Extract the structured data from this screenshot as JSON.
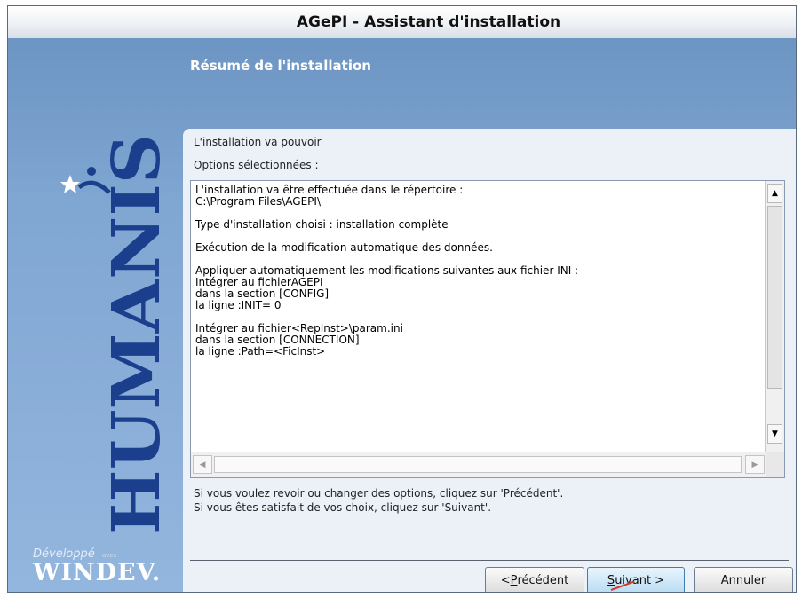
{
  "window": {
    "title": "AGePI - Assistant d'installation"
  },
  "sidebar": {
    "brand": "HUMANIS",
    "footer_developed": "Développé",
    "footer_avec": "avec",
    "footer_product": "WINDEV."
  },
  "page": {
    "section_title": "Résumé de l'installation",
    "intro": "L'installation va pouvoir",
    "options_label": "Options sélectionnées :",
    "summary_lines": [
      "L'installation va être effectuée dans le répertoire :",
      "C:\\Program Files\\AGEPI\\",
      "",
      "Type d'installation choisi : installation complète",
      "",
      "Exécution de la modification automatique des données.",
      "",
      "Appliquer automatiquement les modifications suivantes aux fichier INI :",
      "Intégrer au fichierAGEPI",
      "dans la section [CONFIG]",
      "la ligne :INIT= 0",
      "",
      "Intégrer au fichier<RepInst>\\param.ini",
      "dans la section [CONNECTION]",
      "la ligne :Path=<FicInst>"
    ],
    "help_line1": "Si vous voulez revoir ou changer des options, cliquez sur 'Précédent'.",
    "help_line2": "Si vous êtes satisfait de vos choix, cliquez sur 'Suivant'."
  },
  "buttons": {
    "previous": {
      "prefix": "< ",
      "accel": "P",
      "rest": "récédent"
    },
    "next": {
      "accel": "S",
      "rest": "uivant >"
    },
    "cancel": "Annuler"
  },
  "icons": {
    "scroll_up": "up-arrow-icon",
    "scroll_down": "down-arrow-icon",
    "scroll_left": "left-arrow-icon",
    "scroll_right": "right-arrow-icon",
    "brand_figure": "star-figure-icon"
  },
  "colors": {
    "background_blue": "#80a6d2",
    "panel": "#ecf1f8",
    "primary_button": "#b9dcf2"
  }
}
